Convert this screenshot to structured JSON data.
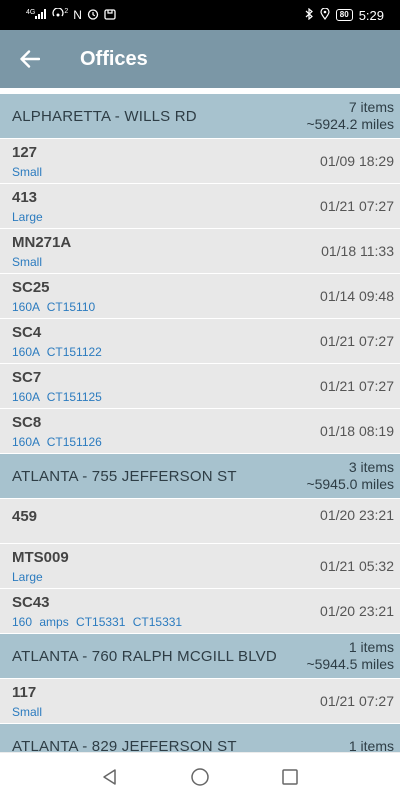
{
  "status_bar": {
    "signal_text": "4G",
    "hd_text": "2",
    "nfc_text": "N",
    "battery": "80",
    "time": "5:29"
  },
  "app_bar": {
    "title": "Offices"
  },
  "groups": [
    {
      "name": "ALPHARETTA - WILLS RD",
      "count": "7 items",
      "distance": "~5924.2 miles",
      "rows": [
        {
          "name": "127",
          "sub": "Small",
          "time": "01/09 18:29"
        },
        {
          "name": "413",
          "sub": "Large",
          "time": "01/21 07:27"
        },
        {
          "name": "MN271A",
          "sub": "Small",
          "time": "01/18 11:33"
        },
        {
          "name": "SC25",
          "sub": "160A  CT15110",
          "time": "01/14 09:48"
        },
        {
          "name": "SC4",
          "sub": "160A  CT151122",
          "time": "01/21 07:27"
        },
        {
          "name": "SC7",
          "sub": "160A  CT151125",
          "time": "01/21 07:27"
        },
        {
          "name": "SC8",
          "sub": "160A  CT151126",
          "time": "01/18 08:19"
        }
      ]
    },
    {
      "name": "ATLANTA - 755 JEFFERSON ST",
      "count": "3 items",
      "distance": "~5945.0 miles",
      "rows": [
        {
          "name": "459",
          "sub": "",
          "time": "01/20 23:21"
        },
        {
          "name": "MTS009",
          "sub": "Large",
          "time": "01/21 05:32"
        },
        {
          "name": "SC43",
          "sub": "160 amps  CT15331  CT15331",
          "time": "01/20 23:21"
        }
      ]
    },
    {
      "name": "ATLANTA - 760 RALPH MCGILL BLVD",
      "count": "1 items",
      "distance": "~5944.5 miles",
      "rows": [
        {
          "name": "117",
          "sub": "Small",
          "time": "01/21 07:27"
        }
      ]
    },
    {
      "name": "ATLANTA - 829 JEFFERSON ST",
      "count": "1 items",
      "distance": "",
      "rows": []
    }
  ]
}
